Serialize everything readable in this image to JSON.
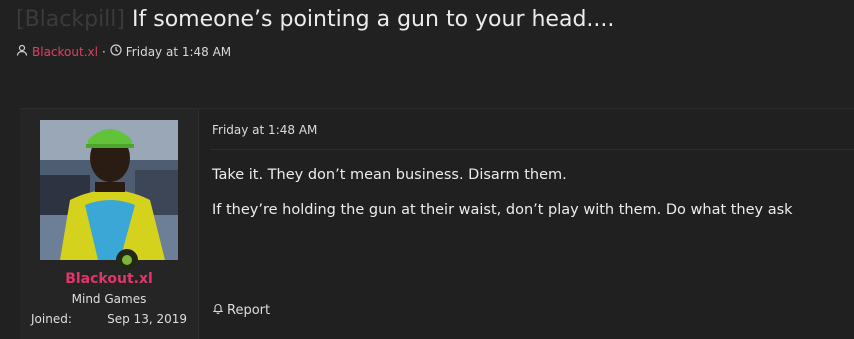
{
  "thread": {
    "prefix": "[Blackpill]",
    "title": "If someone’s pointing a gun to your head....",
    "author": "Blackout.xl",
    "separator": "·",
    "date": "Friday at 1:48 AM"
  },
  "post": {
    "user": {
      "name": "Blackout.xl",
      "title": "Mind Games",
      "joined_label": "Joined:",
      "joined_value": "Sep 13, 2019"
    },
    "date": "Friday at 1:48 AM",
    "paragraphs": [
      "Take it. They don’t mean business. Disarm them.",
      "If they’re holding the gun at their waist, don’t play with them. Do what they ask"
    ],
    "report_label": "Report"
  },
  "icons": {
    "author": "user-icon",
    "time": "clock-icon",
    "report": "bell-icon",
    "online": "online-status-icon"
  },
  "colors": {
    "background": "#212121",
    "username": "#e3356b",
    "online": "#7fb43b"
  }
}
